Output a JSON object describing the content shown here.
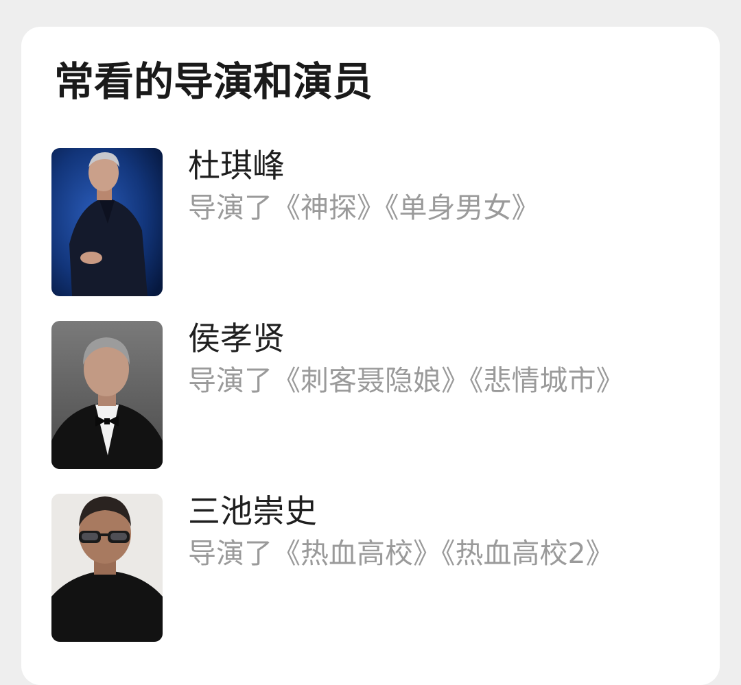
{
  "section": {
    "title": "常看的导演和演员"
  },
  "people": [
    {
      "name": "杜琪峰",
      "works": "导演了《神探》《单身男女》",
      "portrait_icon": "portrait-photo-icon",
      "bg_color": "#0d2a66"
    },
    {
      "name": "侯孝贤",
      "works": "导演了《刺客聂隐娘》《悲情城市》",
      "portrait_icon": "portrait-photo-icon",
      "bg_color": "#6e6e6e"
    },
    {
      "name": "三池崇史",
      "works": "导演了《热血高校》《热血高校2》",
      "portrait_icon": "portrait-photo-icon",
      "bg_color": "#e9e7e4"
    }
  ]
}
